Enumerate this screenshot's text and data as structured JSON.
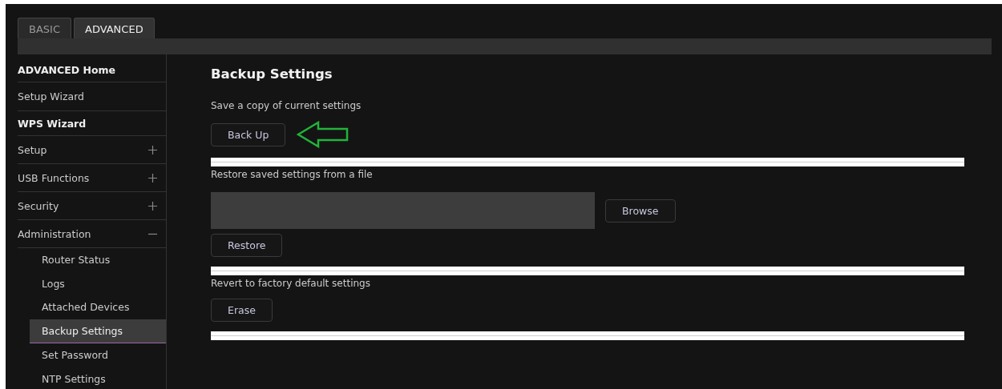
{
  "tabs": [
    {
      "label": "BASIC",
      "selected": false
    },
    {
      "label": "ADVANCED",
      "selected": true
    }
  ],
  "sidebar": {
    "items": [
      {
        "label": "ADVANCED Home",
        "kind": "bold"
      },
      {
        "label": "Setup Wizard",
        "kind": "plain"
      },
      {
        "label": "WPS Wizard",
        "kind": "bold"
      },
      {
        "label": "Setup",
        "kind": "group",
        "expanded": false
      },
      {
        "label": "USB Functions",
        "kind": "group",
        "expanded": false
      },
      {
        "label": "Security",
        "kind": "group",
        "expanded": false
      },
      {
        "label": "Administration",
        "kind": "group",
        "expanded": true,
        "children": [
          {
            "label": "Router Status",
            "selected": false
          },
          {
            "label": "Logs",
            "selected": false
          },
          {
            "label": "Attached Devices",
            "selected": false
          },
          {
            "label": "Backup Settings",
            "selected": true
          },
          {
            "label": "Set Password",
            "selected": false
          },
          {
            "label": "NTP Settings",
            "selected": false
          }
        ]
      }
    ]
  },
  "page": {
    "title": "Backup Settings",
    "sections": [
      {
        "label": "Save a copy of current settings",
        "buttons": [
          "Back Up"
        ],
        "arrow": true
      },
      {
        "label": "Restore saved settings from a file",
        "browse": "Browse",
        "buttons": [
          "Restore"
        ]
      },
      {
        "label": "Revert to factory default settings",
        "buttons": [
          "Erase"
        ]
      }
    ]
  }
}
